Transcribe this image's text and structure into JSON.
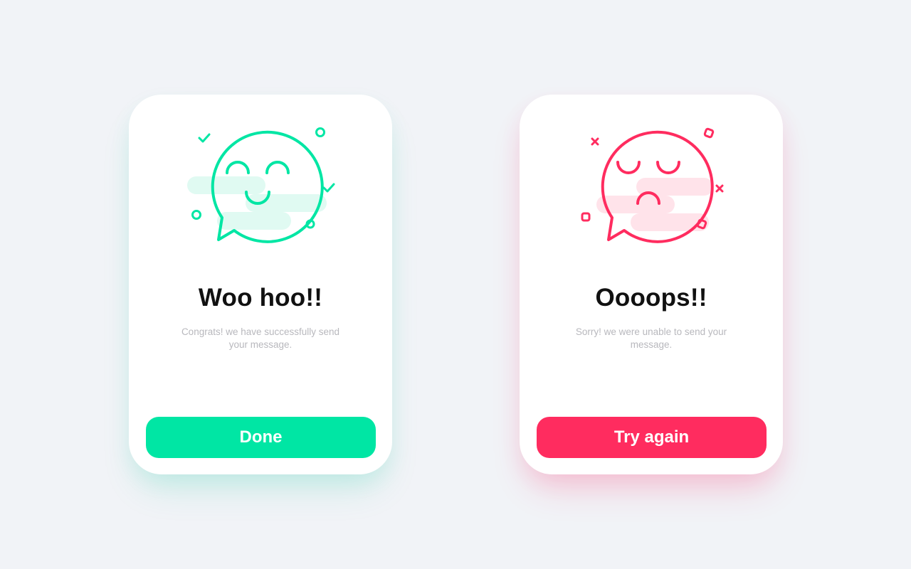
{
  "success_card": {
    "title": "Woo hoo!!",
    "message": "Congrats! we have successfully send your message.",
    "button_label": "Done",
    "accent_color": "#00e6a4",
    "icon": "happy-chat-bubble-icon"
  },
  "error_card": {
    "title": "Oooops!!",
    "message": "Sorry! we were unable to send your message.",
    "button_label": "Try again",
    "accent_color": "#ff2c5f",
    "icon": "sad-chat-bubble-icon"
  },
  "background_color": "#f1f3f7"
}
